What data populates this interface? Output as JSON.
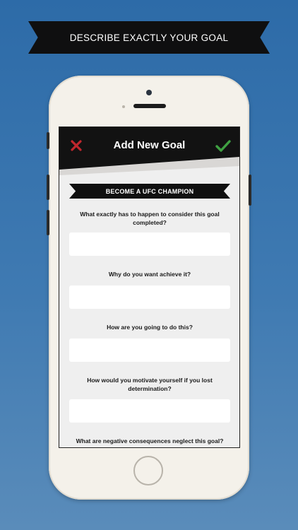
{
  "banner": {
    "text": "DESCRIBE EXACTLY YOUR GOAL"
  },
  "app": {
    "title": "Add New Goal",
    "close_icon": "close-x-icon",
    "confirm_icon": "checkmark-icon",
    "accent_close": "#c0272d",
    "accent_confirm": "#3fa142"
  },
  "goal": {
    "name": "BECOME A UFC CHAMPION"
  },
  "questions": [
    {
      "label": "What exactly has to happen to consider this goal completed?",
      "value": ""
    },
    {
      "label": "Why do you want achieve it?",
      "value": ""
    },
    {
      "label": "How are you going to do this?",
      "value": ""
    },
    {
      "label": "How would you motivate yourself if you lost determination?",
      "value": ""
    },
    {
      "label": "What are negative consequences neglect this goal?",
      "value": ""
    }
  ]
}
